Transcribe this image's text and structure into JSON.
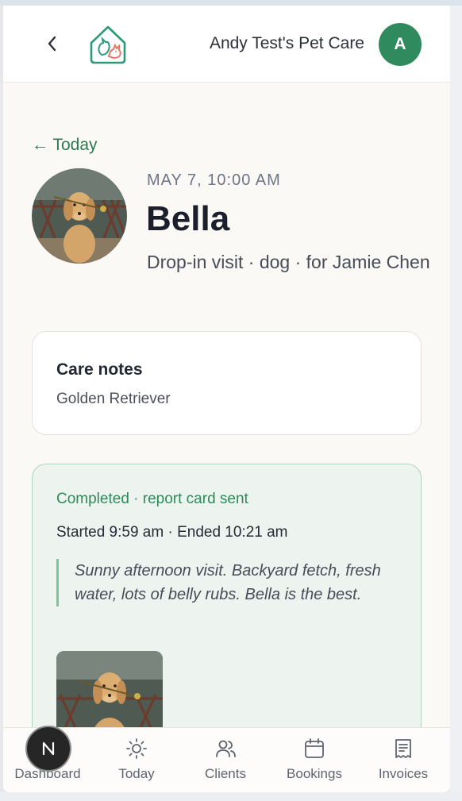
{
  "header": {
    "business_name": "Andy Test's Pet Care",
    "avatar_initial": "A"
  },
  "visit": {
    "back_label": "← Today",
    "time": "MAY 7, 10:00 AM",
    "pet_name": "Bella",
    "description": "Drop-in visit · dog · for Jamie Chen"
  },
  "care_notes": {
    "title": "Care notes",
    "body": "Golden Retriever"
  },
  "report": {
    "status": "Completed · report card sent",
    "times": "Started 9:59 am · Ended 10:21 am",
    "note": "Sunny afternoon visit. Backyard fetch, fresh water, lots of belly rubs. Bella is the best."
  },
  "bottom_nav": {
    "fab_glyph": "N",
    "items": [
      {
        "label": "Dashboard",
        "icon": "dashboard-icon"
      },
      {
        "label": "Today",
        "icon": "sun-icon"
      },
      {
        "label": "Clients",
        "icon": "users-icon"
      },
      {
        "label": "Bookings",
        "icon": "calendar-icon"
      },
      {
        "label": "Invoices",
        "icon": "receipt-icon"
      }
    ]
  },
  "colors": {
    "accent_green": "#2f8a5e",
    "status_green": "#2e8a5a",
    "report_bg": "#edf3ef"
  }
}
